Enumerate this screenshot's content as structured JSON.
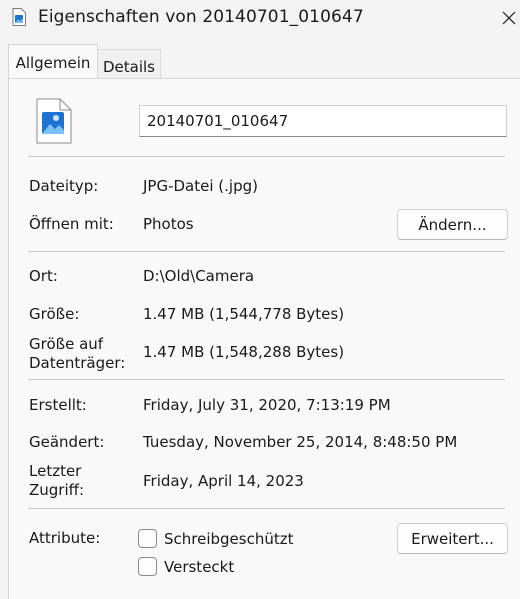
{
  "window": {
    "title": "Eigenschaften von 20140701_010647",
    "title_icon": "image-file-icon",
    "close_icon": "close-icon"
  },
  "tabs": [
    {
      "label": "Allgemein",
      "active": true
    },
    {
      "label": "Details",
      "active": false
    }
  ],
  "file": {
    "icon": "jpg-image-file-icon",
    "name": "20140701_010647"
  },
  "rows": {
    "type": {
      "label": "Dateityp:",
      "value": "JPG-Datei (.jpg)"
    },
    "opens_with": {
      "label": "Öffnen mit:",
      "value": "Photos",
      "button": "Ändern..."
    },
    "location": {
      "label": "Ort:",
      "value": "D:\\Old\\Camera"
    },
    "size": {
      "label": "Größe:",
      "value": "1.47 MB (1,544,778 Bytes)"
    },
    "size_on_disk": {
      "label_line1": "Größe auf",
      "label_line2": "Datenträger:",
      "value": "1.47 MB (1,548,288 Bytes)"
    },
    "created": {
      "label": "Erstellt:",
      "value": "Friday, July 31, 2020, 7:13:19 PM"
    },
    "modified": {
      "label": "Geändert:",
      "value": "Tuesday, November 25, 2014, 8:48:50 PM"
    },
    "accessed": {
      "label_line1": "Letzter",
      "label_line2": "Zugriff:",
      "value": "Friday, April 14, 2023"
    }
  },
  "attributes": {
    "label": "Attribute:",
    "readonly": {
      "label": "Schreibgeschützt",
      "checked": false
    },
    "hidden": {
      "label": "Versteckt",
      "checked": false
    },
    "advanced_button": "Erweitert..."
  },
  "colors": {
    "icon_accent": "#1e73d2",
    "window_bg": "#f3f3f3"
  }
}
